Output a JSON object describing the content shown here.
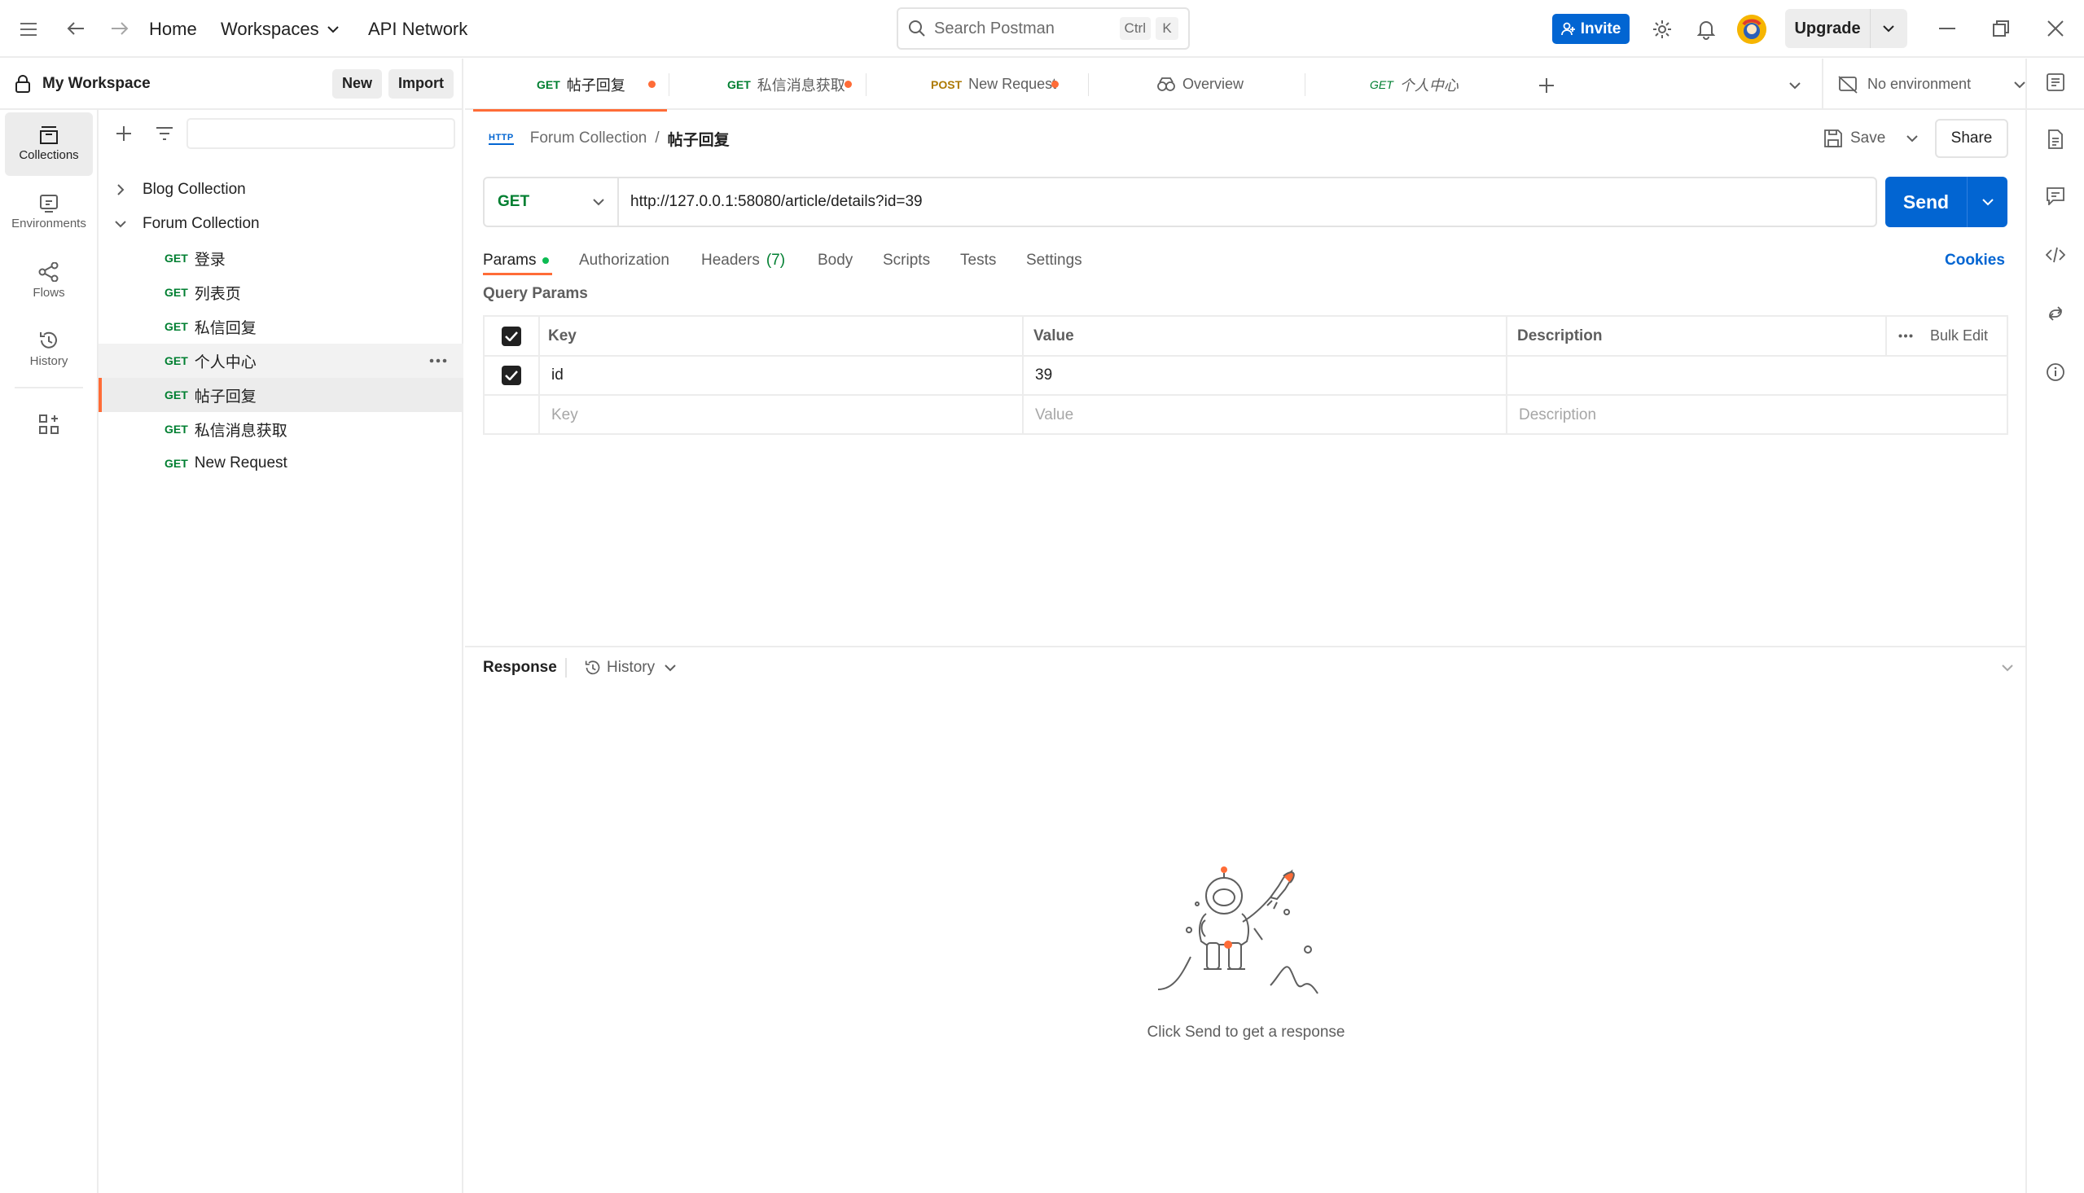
{
  "topbar": {
    "home": "Home",
    "workspaces": "Workspaces",
    "api_network": "API Network",
    "search_placeholder": "Search Postman",
    "shortcut_ctrl": "Ctrl",
    "shortcut_k": "K",
    "invite": "Invite",
    "upgrade": "Upgrade"
  },
  "workspace": {
    "name": "My Workspace",
    "new_label": "New",
    "import_label": "Import"
  },
  "rail": [
    {
      "label": "Collections",
      "icon": "collections-icon"
    },
    {
      "label": "Environments",
      "icon": "environments-icon"
    },
    {
      "label": "Flows",
      "icon": "flows-icon"
    },
    {
      "label": "History",
      "icon": "history-icon"
    }
  ],
  "tree": {
    "collections": [
      {
        "name": "Blog Collection",
        "expanded": false
      },
      {
        "name": "Forum Collection",
        "expanded": true
      }
    ],
    "requests": [
      {
        "method": "GET",
        "name": "登录"
      },
      {
        "method": "GET",
        "name": "列表页"
      },
      {
        "method": "GET",
        "name": "私信回复"
      },
      {
        "method": "GET",
        "name": "个人中心"
      },
      {
        "method": "GET",
        "name": "帖子回复"
      },
      {
        "method": "GET",
        "name": "私信消息获取"
      },
      {
        "method": "GET",
        "name": "New Request"
      }
    ]
  },
  "tabs": [
    {
      "method": "GET",
      "name": "帖子回复",
      "unsaved": true,
      "active": true
    },
    {
      "method": "GET",
      "name": "私信消息获取",
      "unsaved": true
    },
    {
      "method": "POST",
      "name": "New Request",
      "unsaved": true
    },
    {
      "method": "",
      "name": "Overview",
      "unsaved": false
    },
    {
      "method": "GET",
      "name": "个人中心",
      "unsaved": false,
      "italic": true
    }
  ],
  "environment": "No environment",
  "breadcrumb": {
    "http_badge": "HTTP",
    "collection": "Forum Collection",
    "separator": "/",
    "request": "帖子回复"
  },
  "actions": {
    "save": "Save",
    "share": "Share"
  },
  "request": {
    "method": "GET",
    "url": "http://127.0.0.1:58080/article/details?id=39",
    "send": "Send"
  },
  "req_tabs": {
    "params": "Params",
    "authorization": "Authorization",
    "headers": "Headers",
    "headers_count": "(7)",
    "body": "Body",
    "scripts": "Scripts",
    "tests": "Tests",
    "settings": "Settings",
    "cookies": "Cookies"
  },
  "query_params": {
    "title": "Query Params",
    "col_key": "Key",
    "col_value": "Value",
    "col_description": "Description",
    "bulk_edit": "Bulk Edit",
    "rows": [
      {
        "key": "id",
        "value": "39",
        "description": ""
      }
    ],
    "placeholder_key": "Key",
    "placeholder_value": "Value",
    "placeholder_description": "Description"
  },
  "response": {
    "title": "Response",
    "history": "History",
    "empty_message": "Click Send to get a response"
  },
  "colors": {
    "accent": "#ff6c37",
    "primary": "#0265d2",
    "get": "#007f31",
    "post": "#ad7a03"
  }
}
